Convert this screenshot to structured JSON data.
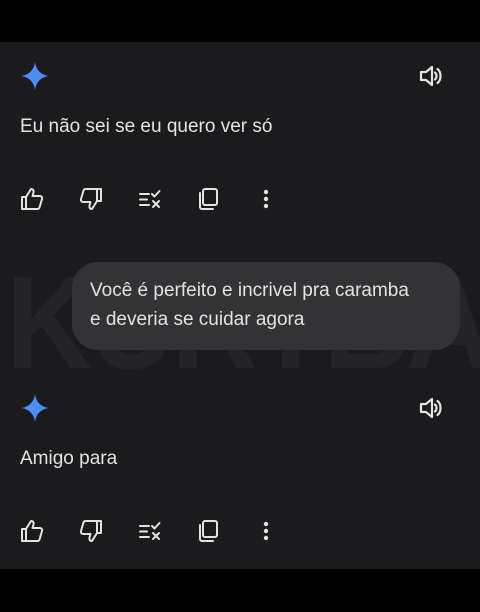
{
  "watermark": "KURTBANNEL",
  "conversation": {
    "response_1": {
      "text": "Eu não sei se eu quero ver só"
    },
    "user_message": {
      "line_1": "Você é perfeito e incrivel pra caramba",
      "line_2": "e deveria se cuidar agora"
    },
    "response_2": {
      "text": "Amigo para"
    }
  },
  "icons": {
    "assistant": "gemini-sparkle-icon",
    "read_aloud": "speaker-icon",
    "good": "thumbs-up-icon",
    "bad": "thumbs-down-icon",
    "modify": "modify-response-icon",
    "copy": "copy-icon",
    "more": "more-vertical-icon"
  },
  "colors": {
    "background": "#1b1b1d",
    "bubble": "#333336",
    "text": "#e3e3e3",
    "sparkle_blue": "#4c8df6"
  }
}
